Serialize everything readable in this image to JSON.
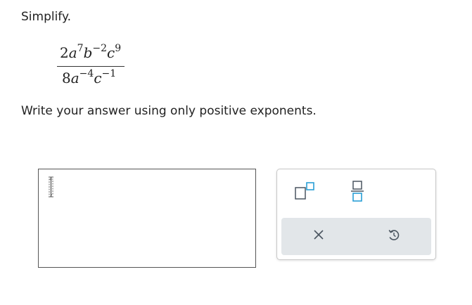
{
  "problem": {
    "instruction": "Simplify.",
    "numerator": {
      "coefficient": "2",
      "terms": [
        {
          "base": "a",
          "exponent": "7"
        },
        {
          "base": "b",
          "exponent": "−2"
        },
        {
          "base": "c",
          "exponent": "9"
        }
      ]
    },
    "denominator": {
      "coefficient": "8",
      "terms": [
        {
          "base": "a",
          "exponent": "−4"
        },
        {
          "base": "c",
          "exponent": "−1"
        }
      ]
    },
    "prompt": "Write your answer using only positive exponents."
  },
  "answer": {
    "value": ""
  },
  "toolbox": {
    "tools": [
      {
        "name": "exponent",
        "icon": "superscript-template-icon"
      },
      {
        "name": "fraction",
        "icon": "fraction-template-icon"
      }
    ],
    "actions": [
      {
        "name": "clear",
        "icon": "close-icon"
      },
      {
        "name": "undo",
        "icon": "undo-icon"
      }
    ],
    "colors": {
      "accent": "#2a9fd6",
      "action_bar": "#e2e6e9",
      "icon": "#4a5560"
    }
  }
}
